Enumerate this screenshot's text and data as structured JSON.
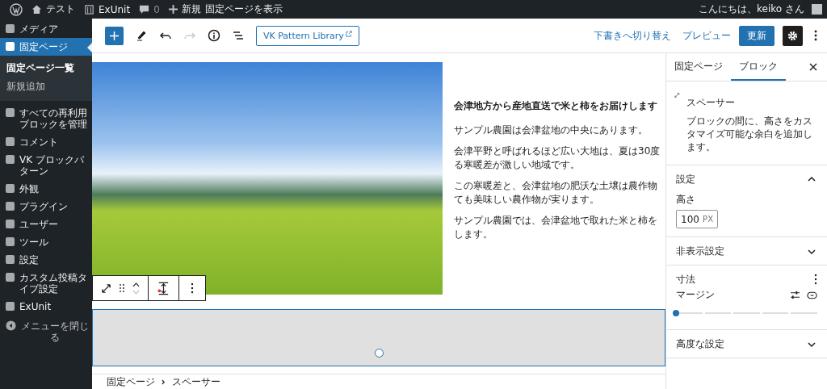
{
  "admin_bar": {
    "site": "テスト",
    "plugin": "ExUnit",
    "comments": "0",
    "new": "新規",
    "view": "固定ページを表示",
    "greeting": "こんにちは、keiko さん"
  },
  "sidebar": {
    "items": [
      {
        "label": "メディア",
        "selected": false
      },
      {
        "label": "固定ページ",
        "selected": true,
        "children": [
          {
            "label": "固定ページ一覧",
            "selected": true
          },
          {
            "label": "新規追加",
            "selected": false
          }
        ]
      },
      {
        "label": "すべての再利用ブロックを管理",
        "selected": false
      },
      {
        "label": "コメント",
        "selected": false
      },
      {
        "label": "VK ブロックパターン",
        "selected": false
      },
      {
        "label": "外観",
        "selected": false
      },
      {
        "label": "プラグイン",
        "selected": false
      },
      {
        "label": "ユーザー",
        "selected": false
      },
      {
        "label": "ツール",
        "selected": false
      },
      {
        "label": "設定",
        "selected": false
      },
      {
        "label": "カスタム投稿タイプ設定",
        "selected": false
      },
      {
        "label": "ExUnit",
        "selected": false
      }
    ],
    "collapse": "メニューを閉じる"
  },
  "toolbar": {
    "redo_disabled": true,
    "pattern_library": "VK Pattern Library",
    "switch_draft": "下書きへ切り替え",
    "preview": "プレビュー",
    "update": "更新",
    "settings_pressed": true
  },
  "content": {
    "heading": "会津地方から産地直送で米と柿をお届けします",
    "paragraphs": [
      [
        "サンプル農園は会津盆地の中央にあります。"
      ],
      [
        "会津平野と呼ばれるほど広い大地は、夏は30度",
        "る寒暖差が激しい地域です。"
      ],
      [
        "この寒暖差と、会津盆地の肥沃な土壌は農作物",
        "ても美味しい農作物が実ります。"
      ],
      [
        "サンプル農園では、会津盆地で取れた米と柿を",
        "します。"
      ]
    ]
  },
  "breadcrumb": [
    "固定ページ",
    "スペーサー"
  ],
  "panel": {
    "tabs": [
      {
        "label": "固定ページ",
        "selected": false
      },
      {
        "label": "ブロック",
        "selected": true
      }
    ],
    "block_name": "スペーサー",
    "block_desc": "ブロックの間に、高さをカスタマイズ可能な余白を追加します。",
    "settings": {
      "title": "設定",
      "expanded": true,
      "height_label": "高さ",
      "height_value": "100",
      "unit": "PX"
    },
    "visibility": {
      "title": "非表示設定",
      "expanded": false
    },
    "dimensions": {
      "title": "寸法",
      "margin_label": "マージン",
      "level": 0
    },
    "advanced": {
      "title": "高度な設定",
      "expanded": false
    }
  }
}
